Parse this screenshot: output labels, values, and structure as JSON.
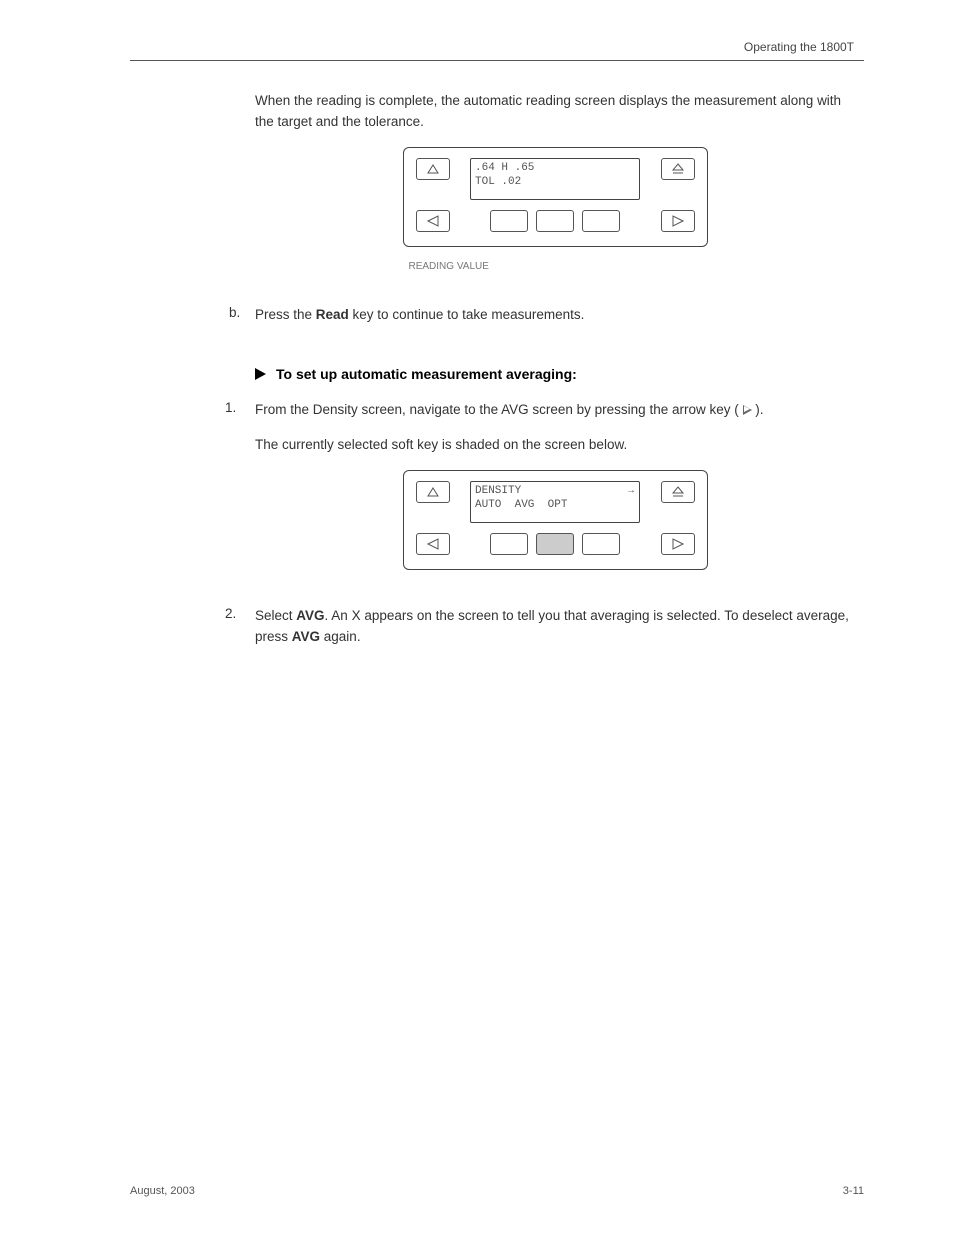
{
  "header": "Operating the 1800T",
  "para1": "When the reading is complete, the automatic reading screen displays the measurement along with the target and the tolerance.",
  "device1": {
    "lcd_line1": ".64 H .65",
    "lcd_line2": "TOL .02"
  },
  "reading_hint": "READING VALUE",
  "substep_b": {
    "label": "b.",
    "text_prefix": "Press the ",
    "key": "Read",
    "text_suffix": " key to continue to take measurements."
  },
  "procedure_title": "To set up automatic measurement averaging:",
  "step1": {
    "num": "1.",
    "text_before": "From the Density screen, navigate to the AVG screen by pressing the arrow key (",
    "text_after": ").",
    "note": "The currently selected soft key is shaded on the screen below."
  },
  "device2": {
    "lcd_line1": "DENSITY",
    "lcd_line2": "AUTO  AVG  OPT",
    "arrow": "→"
  },
  "step2": {
    "num": "2.",
    "text_before": "Select ",
    "key": "AVG",
    "text_mid": ". An X appears on the screen to tell you that averaging is selected. To deselect average, press ",
    "key2": "AVG",
    "text_after": " again."
  },
  "footer_left": "August, 2003",
  "footer_right": "3-11"
}
